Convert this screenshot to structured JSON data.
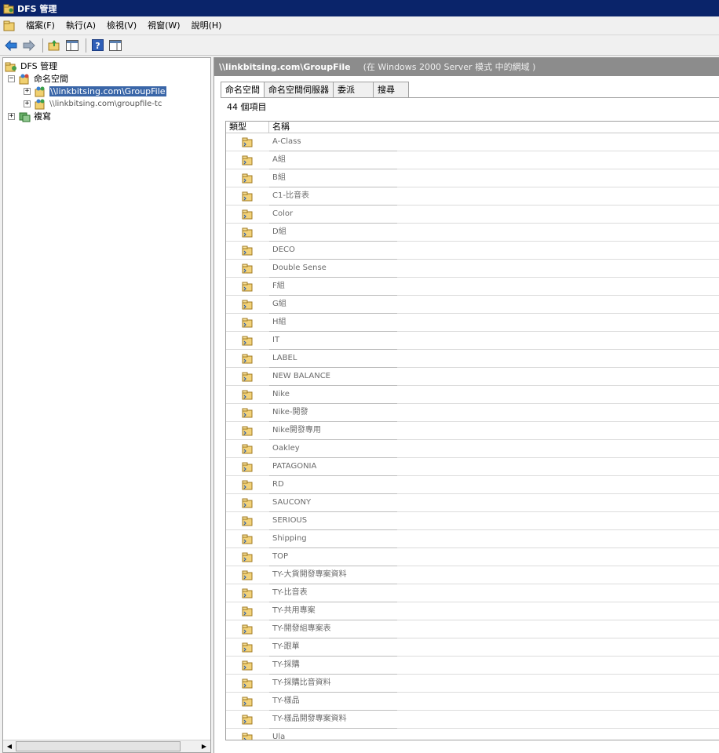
{
  "window": {
    "title": "DFS 管理"
  },
  "menu": [
    "檔案(F)",
    "執行(A)",
    "檢視(V)",
    "視窗(W)",
    "說明(H)"
  ],
  "toolbar": [
    "back-icon",
    "forward-icon",
    "up-icon",
    "show-hide-tree-icon",
    "help-icon",
    "properties-icon"
  ],
  "tree": {
    "root": "DFS 管理",
    "namespaces": "命名空間",
    "ns1": "\\\\linkbitsing.com\\GroupFile",
    "ns2": "\\\\linkbitsing.com\\groupfile-tc",
    "replication": "複寫"
  },
  "header": {
    "path": "\\\\linkbitsing.com\\GroupFile",
    "mode": "(在 Windows 2000 Server 模式 中的網域 )"
  },
  "tabs": [
    "命名空間",
    "命名空間伺服器",
    "委派",
    "搜尋"
  ],
  "list": {
    "count": "44 個項目",
    "columns": {
      "type": "類型",
      "name": "名稱"
    },
    "items": [
      "A-Class",
      "A組",
      "B組",
      "C1-比音表",
      "Color",
      "D組",
      "DECO",
      "Double Sense",
      "F組",
      "G組",
      "H組",
      "IT",
      "LABEL",
      "NEW BALANCE",
      "Nike",
      "Nike-開發",
      "Nike開發專用",
      "Oakley",
      "PATAGONIA",
      "RD",
      "SAUCONY",
      "SERIOUS",
      "Shipping",
      "TOP",
      "TY-大貨開發專案資料",
      "TY-比音表",
      "TY-共用專案",
      "TY-開發組專案表",
      "TY-跟單",
      "TY-採購",
      "TY-採購比音資料",
      "TY-樣品",
      "TY-樣品開發專案資料",
      "Ula"
    ]
  }
}
